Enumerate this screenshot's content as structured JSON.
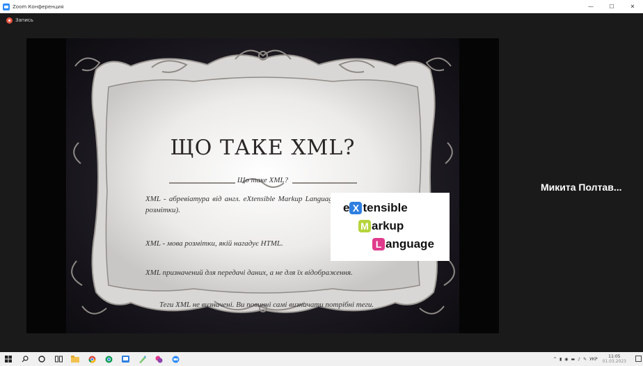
{
  "window": {
    "title": "Zoom Конференция",
    "controls": {
      "minimize": "—",
      "maximize": "☐",
      "close": "✕"
    }
  },
  "recording": {
    "label": "Запись",
    "color": "#e8533f"
  },
  "slide": {
    "title": "ЩО ТАКЕ XML?",
    "subtitle": "Що таке XML?",
    "paragraphs": [
      "XML - абревіатура від англ. eXtensible Markup Language (пров. розширювана мова розмітки).",
      "XML - мова розмітки, якій нагадує HTML.",
      "XML призначений для передачі даних, а не для їх відображення.",
      "Теги XML не визначені. Ви повинні самі визначати потрібні теги."
    ],
    "logo": {
      "line1": {
        "letter": "X",
        "prefix": "e",
        "rest": "tensible",
        "color": "#2d7fe0"
      },
      "line2": {
        "letter": "M",
        "rest": "arkup",
        "color": "#b6d43c"
      },
      "line3": {
        "letter": "L",
        "rest": "anguage",
        "color": "#e03a8c"
      }
    }
  },
  "participant": {
    "name": "Микита Полтав..."
  },
  "taskbar": {
    "icons": [
      "windows-start-icon",
      "search-icon",
      "cortana-icon",
      "task-view-icon",
      "file-explorer-icon",
      "chrome-icon",
      "chrome-icon",
      "app-icon",
      "paint-icon",
      "app-icon",
      "zoom-icon"
    ],
    "tray": {
      "language": "УКР",
      "time": "11:05",
      "date": "01.03.2023"
    }
  }
}
